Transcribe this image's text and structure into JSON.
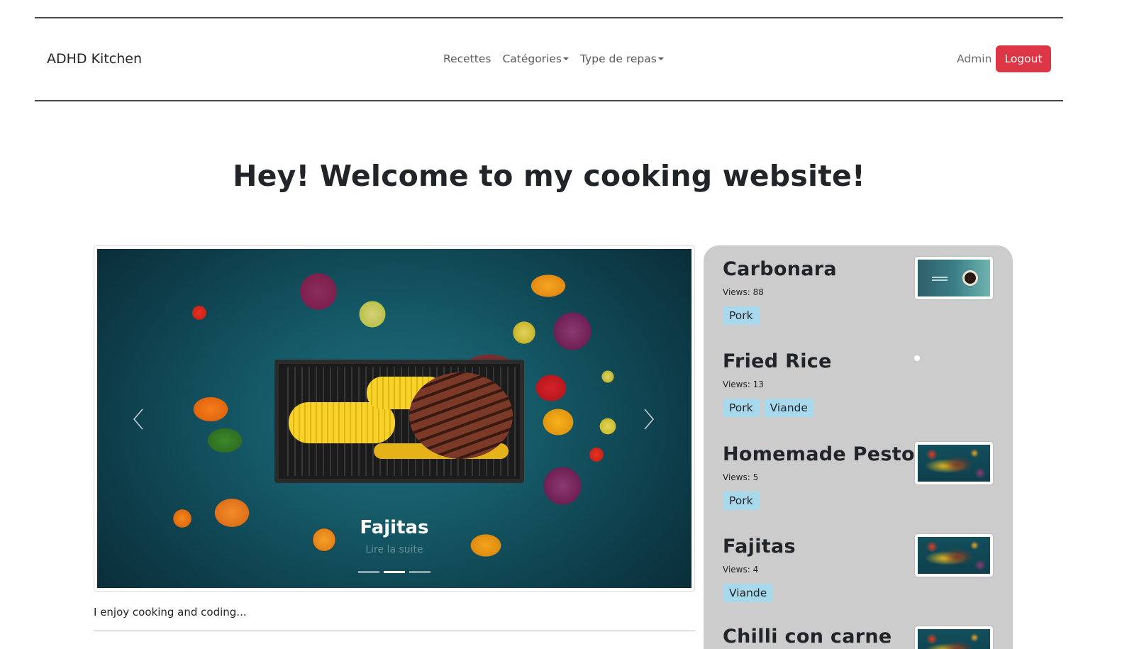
{
  "navbar": {
    "brand": "ADHD Kitchen",
    "links": [
      {
        "label": "Recettes",
        "dropdown": false
      },
      {
        "label": "Catégories",
        "dropdown": true
      },
      {
        "label": "Type de repas",
        "dropdown": true
      }
    ],
    "admin": "Admin",
    "logout": "Logout"
  },
  "headline": "Hey! Welcome to my cooking website!",
  "carousel": {
    "caption_title": "Fajitas",
    "caption_link": "Lire la suite",
    "slide_count": 3,
    "active_slide": 2
  },
  "intro": "I enjoy cooking and coding...",
  "sidebar": {
    "recipes": [
      {
        "title": "Carbonara",
        "views": "Views: 88",
        "tags": [
          "Pork"
        ],
        "thumb": "slide"
      },
      {
        "title": "Fried Rice",
        "views": "Views: 13",
        "tags": [
          "Pork",
          "Viande"
        ],
        "thumb": "none"
      },
      {
        "title": "Homemade Pesto",
        "views": "Views: 5",
        "tags": [
          "Pork"
        ],
        "thumb": "food"
      },
      {
        "title": "Fajitas",
        "views": "Views: 4",
        "tags": [
          "Viande"
        ],
        "thumb": "food"
      },
      {
        "title": "Chilli con carne",
        "views": "",
        "tags": [],
        "thumb": "food"
      }
    ]
  },
  "colors": {
    "logout_bg": "#dc3545",
    "tag_bg": "#a8d8ec",
    "sidebar_bg": "#cccccc"
  }
}
